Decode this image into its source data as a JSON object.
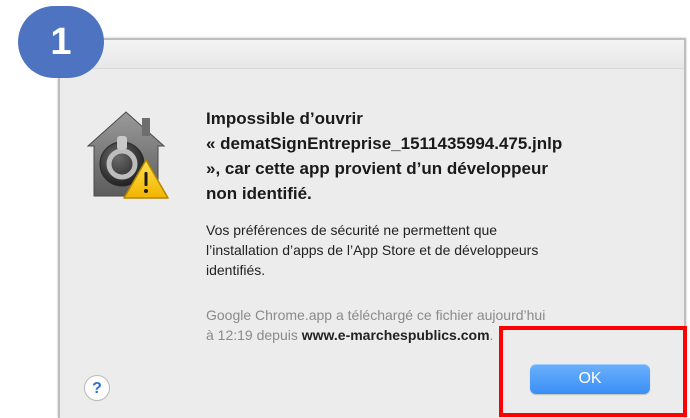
{
  "step_badge": {
    "number": "1",
    "color": "#4d73c1"
  },
  "dialog": {
    "icon": "security-lock-warning-icon",
    "title_line1": "Impossible d’ouvrir",
    "title_line2": "« dematSignEntreprise_1511435994.475.jnlp",
    "title_line3": "», car cette app provient d’un développeur",
    "title_line4": "non identifié.",
    "body_line1": "Vos préférences de sécurité ne permettent que",
    "body_line2": "l’installation d’apps de l’App Store et de développeurs",
    "body_line3": "identifiés.",
    "info_line1": "Google Chrome.app a téléchargé ce fichier aujourd’hui",
    "info_line2_prefix": "à 12:19 depuis ",
    "info_line2_site": "www.e-marchespublics.com",
    "info_line2_suffix": ".",
    "help_label": "?",
    "ok_label": "OK"
  },
  "colors": {
    "ok_button": "#3a8ff7",
    "highlight": "#ff0000",
    "dialog_bg": "#ececec"
  }
}
